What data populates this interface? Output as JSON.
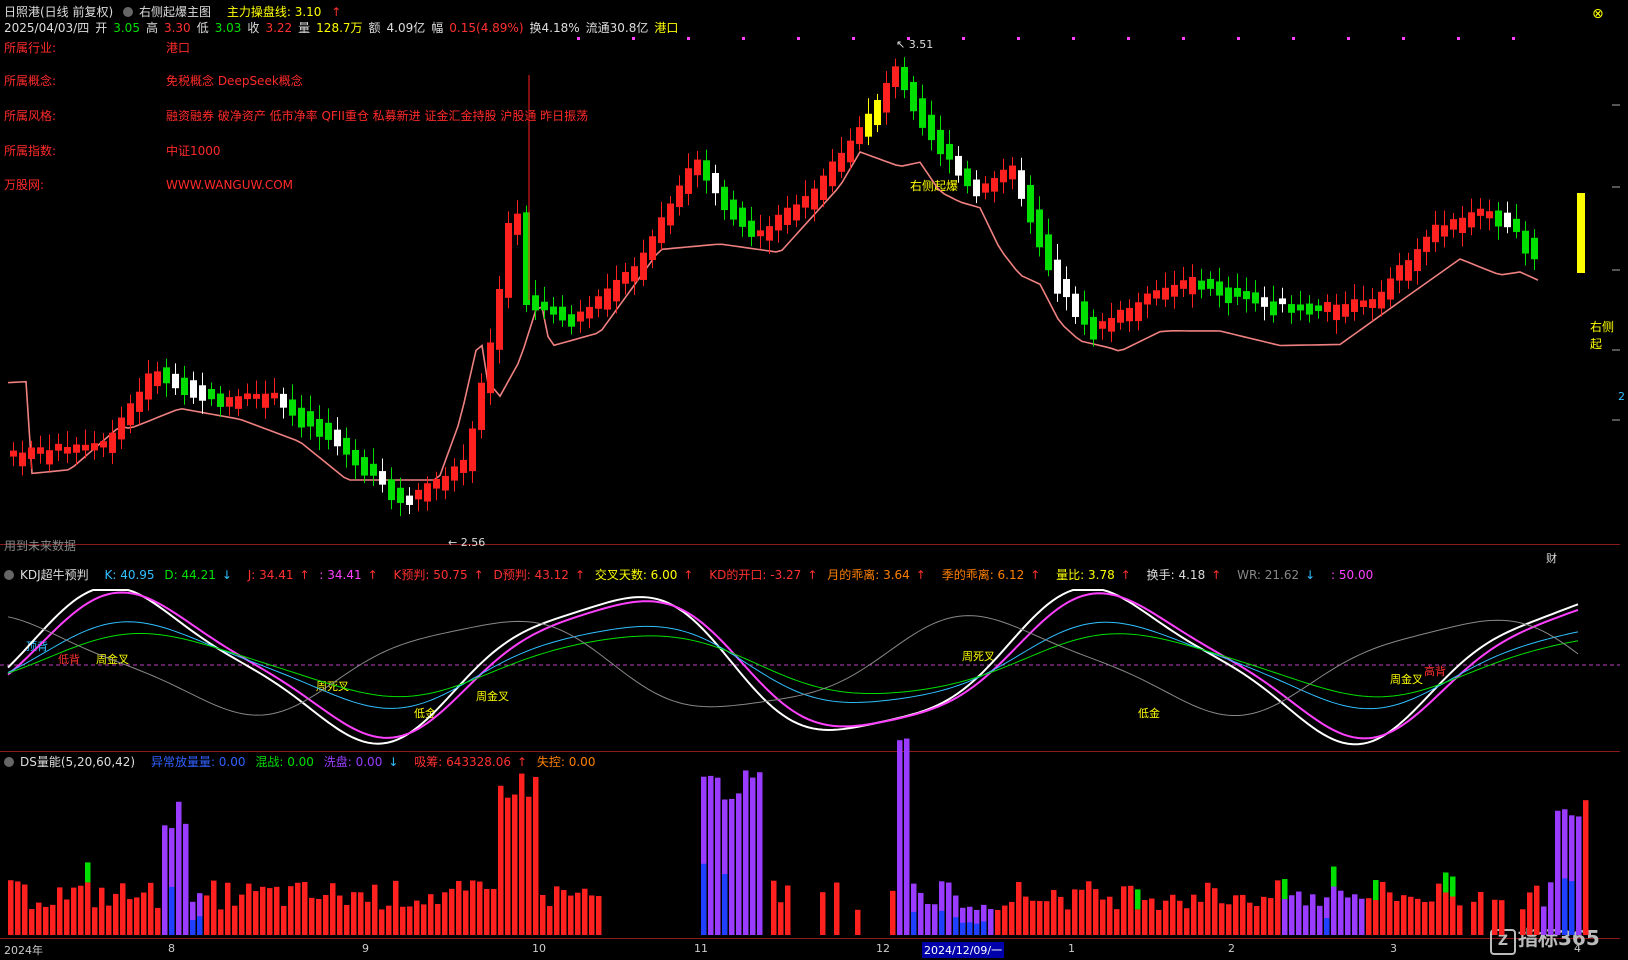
{
  "main": {
    "stock": "日照港(日线 前复权)",
    "indicator": "右侧起爆主图",
    "line_label": "主力操盘线: 3.10",
    "date": "2025/04/03/四",
    "open_label": "开",
    "open": "3.05",
    "high_label": "高",
    "high": "3.30",
    "low_label": "低",
    "low": "3.03",
    "close_label": "收",
    "close": "3.22",
    "vol_label": "量",
    "vol": "128.7万",
    "amt_label": "额",
    "amt": "4.09亿",
    "chg_label": "幅",
    "chg": "0.15(4.89%)",
    "turnover": "换4.18%",
    "float": "流通30.8亿",
    "sector_tag": "港口",
    "max_label": "3.51",
    "min_label": "2.56",
    "signal_label": "右侧起爆",
    "signal_label_right": "右侧起",
    "future_note": "用到未来数据",
    "cai": "财",
    "right_mark": "2"
  },
  "info": [
    {
      "label": "所属行业:",
      "value": "港口"
    },
    {
      "label": "所属概念:",
      "value": "免税概念 DeepSeek概念"
    },
    {
      "label": "所属风格:",
      "value": "融资融券 破净资产 低市净率 QFII重仓 私募新进 证金汇金持股 沪股通 昨日振荡"
    },
    {
      "label": "所属指数:",
      "value": "中证1000"
    },
    {
      "label": "万股网:",
      "value": "WWW.WANGUW.COM"
    }
  ],
  "kdj": {
    "title": "KDJ超牛预判",
    "k": "K: 40.95",
    "d": "D: 44.21",
    "j": "J: 34.41",
    "j2": ": 34.41",
    "kpre": "K预判: 50.75",
    "dpre": "D预判: 43.12",
    "cross": "交叉天数: 6.00",
    "kd_open": "KD的开口: -3.27",
    "month": "月的乖离: 3.64",
    "season": "季的乖离: 6.12",
    "vr": "量比: 3.78",
    "hs": "换手: 4.18",
    "wr": "WR: 21.62",
    "fifty": ": 50.00",
    "labels": [
      "顶背",
      "低背",
      "周金叉",
      "周死叉",
      "低金",
      "周金叉",
      "周死叉",
      "低金",
      "周金叉",
      "高背"
    ]
  },
  "ds": {
    "title": "DS量能(5,20,60,42)",
    "abn": "异常放量量: 0.00",
    "mix": "混战: 0.00",
    "wash": "洗盘: 0.00",
    "absorb": "吸筹: 643328.06",
    "lose": "失控: 0.00"
  },
  "axis": {
    "labels": [
      "2024年",
      "8",
      "9",
      "10",
      "11",
      "12",
      "2024/12/09/一",
      "1",
      "2",
      "3",
      "4"
    ]
  },
  "brand": "指标365",
  "colors": {
    "up": "#ff2020",
    "down": "#00e000",
    "ma": "#f08080",
    "bg": "#000000"
  }
}
